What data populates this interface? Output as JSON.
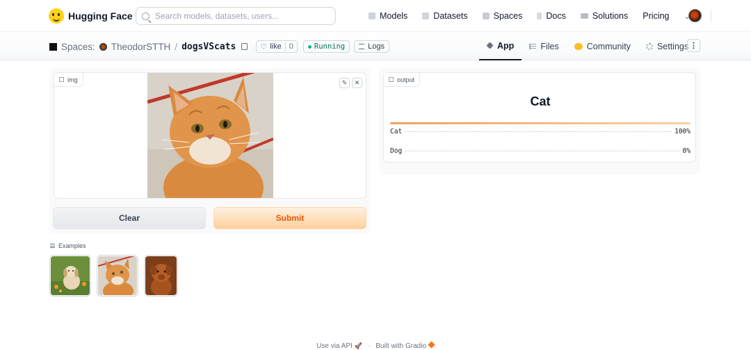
{
  "nav": {
    "brand": "Hugging Face",
    "search_placeholder": "Search models, datasets, users...",
    "links": [
      "Models",
      "Datasets",
      "Spaces",
      "Docs",
      "Solutions",
      "Pricing"
    ]
  },
  "space": {
    "section_label": "Spaces:",
    "owner": "TheodorSTTH",
    "name": "dogsVScats",
    "like_label": "like",
    "like_count": "0",
    "status": "Running",
    "logs_label": "Logs",
    "tabs": [
      "App",
      "Files",
      "Community",
      "Settings"
    ],
    "active_tab": "App"
  },
  "app": {
    "input_label": "img",
    "clear_label": "Clear",
    "submit_label": "Submit",
    "examples_label": "Examples",
    "output_label": "output",
    "prediction": "Cat",
    "confidences": [
      {
        "label": "Cat",
        "value": "100%",
        "fraction": 1.0
      },
      {
        "label": "Dog",
        "value": "0%",
        "fraction": 0.0
      }
    ]
  },
  "footer": {
    "api_label": "Use via API",
    "built_label": "Built with Gradio"
  },
  "colors": {
    "accent": "#ea580c",
    "running": "#10b981"
  }
}
